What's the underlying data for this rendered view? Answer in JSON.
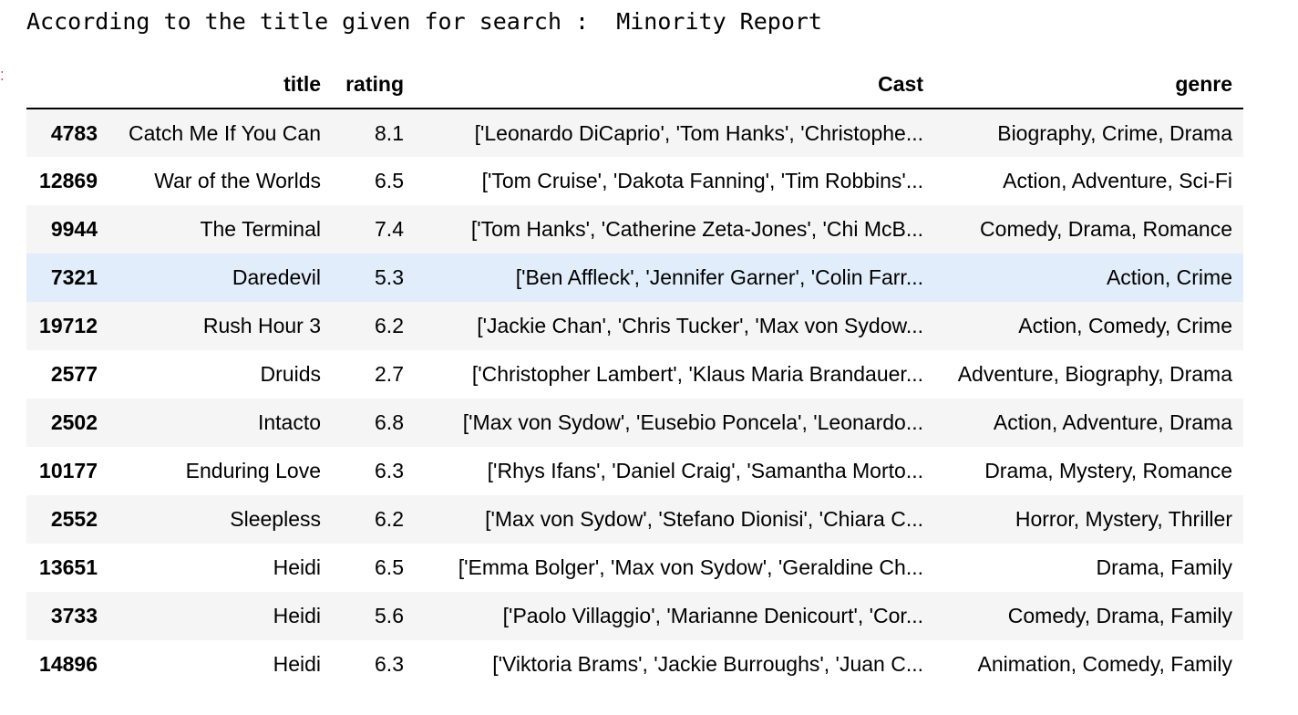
{
  "output": {
    "printed_line": "According to the title given for search :  Minority Report"
  },
  "dataframe": {
    "columns": [
      "",
      "title",
      "rating",
      "Cast",
      "genre"
    ],
    "rows": [
      {
        "index": "4783",
        "title": "Catch Me If You Can",
        "rating": "8.1",
        "cast": "['Leonardo DiCaprio', 'Tom Hanks', 'Christophe...",
        "genre": "Biography, Crime, Drama"
      },
      {
        "index": "12869",
        "title": "War of the Worlds",
        "rating": "6.5",
        "cast": "['Tom Cruise', 'Dakota Fanning', 'Tim Robbins'...",
        "genre": "Action, Adventure, Sci-Fi"
      },
      {
        "index": "9944",
        "title": "The Terminal",
        "rating": "7.4",
        "cast": "['Tom Hanks', 'Catherine Zeta-Jones', 'Chi McB...",
        "genre": "Comedy, Drama, Romance"
      },
      {
        "index": "7321",
        "title": "Daredevil",
        "rating": "5.3",
        "cast": "['Ben Affleck', 'Jennifer Garner', 'Colin Farr...",
        "genre": "Action, Crime"
      },
      {
        "index": "19712",
        "title": "Rush Hour 3",
        "rating": "6.2",
        "cast": "['Jackie Chan', 'Chris Tucker', 'Max von Sydow...",
        "genre": "Action, Comedy, Crime"
      },
      {
        "index": "2577",
        "title": "Druids",
        "rating": "2.7",
        "cast": "['Christopher Lambert', 'Klaus Maria Brandauer...",
        "genre": "Adventure, Biography, Drama"
      },
      {
        "index": "2502",
        "title": "Intacto",
        "rating": "6.8",
        "cast": "['Max von Sydow', 'Eusebio Poncela', 'Leonardo...",
        "genre": "Action, Adventure, Drama"
      },
      {
        "index": "10177",
        "title": "Enduring Love",
        "rating": "6.3",
        "cast": "['Rhys Ifans', 'Daniel Craig', 'Samantha Morto...",
        "genre": "Drama, Mystery, Romance"
      },
      {
        "index": "2552",
        "title": "Sleepless",
        "rating": "6.2",
        "cast": "['Max von Sydow', 'Stefano Dionisi', 'Chiara C...",
        "genre": "Horror, Mystery, Thriller"
      },
      {
        "index": "13651",
        "title": "Heidi",
        "rating": "6.5",
        "cast": "['Emma Bolger', 'Max von Sydow', 'Geraldine Ch...",
        "genre": "Drama, Family"
      },
      {
        "index": "3733",
        "title": "Heidi",
        "rating": "5.6",
        "cast": "['Paolo Villaggio', 'Marianne Denicourt', 'Cor...",
        "genre": "Comedy, Drama, Family"
      },
      {
        "index": "14896",
        "title": "Heidi",
        "rating": "6.3",
        "cast": "['Viktoria Brams', 'Jackie Burroughs', 'Juan C...",
        "genre": "Animation, Comedy, Family"
      }
    ],
    "hovered_row_index": "7321"
  },
  "colors": {
    "row_odd": "#f5f5f5",
    "row_even": "#ffffff",
    "row_hover": "#e1edfa",
    "header_rule": "#000000",
    "prompt_marker": "#d32f2f"
  }
}
